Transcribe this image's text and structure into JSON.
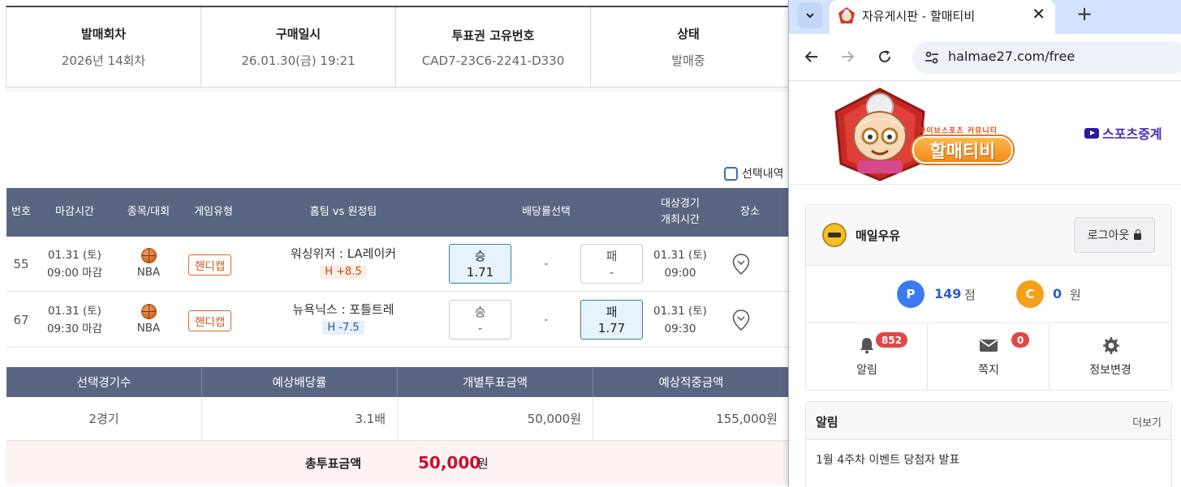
{
  "purchase_info": {
    "round_label": "발매회차",
    "round_value": "2026년 14회차",
    "date_label": "구매일시",
    "date_value": "26.01.30(금) 19:21",
    "id_label": "투표권 고유번호",
    "id_value": "CAD7-23C6-2241-D330",
    "status_label": "상태",
    "status_value": "발매중"
  },
  "selection_toggle_label": "선택내역",
  "game_table": {
    "headers": {
      "num": "번호",
      "deadline": "마감시간",
      "sport": "종목/대회",
      "type": "게임유형",
      "teams": "홈팀 vs 원정팀",
      "odds": "배당률선택",
      "start_line1": "대상경기",
      "start_line2": "개최시간",
      "venue": "장소"
    },
    "rows": [
      {
        "num": "55",
        "deadline_date": "01.31 (토)",
        "deadline_time": "09:00 마감",
        "league": "NBA",
        "game_type": "핸디캡",
        "teams": "워싱위저 : LA레이커",
        "handicap": "H +8.5",
        "win_label": "승",
        "win_odds": "1.71",
        "draw": "-",
        "lose_label": "패",
        "lose_odds": "-",
        "selected": "win",
        "start_date": "01.31 (토)",
        "start_time": "09:00"
      },
      {
        "num": "67",
        "deadline_date": "01.31 (토)",
        "deadline_time": "09:30 마감",
        "league": "NBA",
        "game_type": "핸디캡",
        "teams": "뉴욕닉스 : 포틀트레",
        "handicap": "H -7.5",
        "win_label": "승",
        "win_odds": "-",
        "draw": "-",
        "lose_label": "패",
        "lose_odds": "1.77",
        "selected": "lose",
        "start_date": "01.31 (토)",
        "start_time": "09:30"
      }
    ]
  },
  "summary": {
    "headers": [
      "선택경기수",
      "예상배당률",
      "개별투표금액",
      "예상적중금액"
    ],
    "values": [
      "2경기",
      "3.1배",
      "50,000원",
      "155,000원"
    ],
    "total_label": "총투표금액",
    "total_amount": "50,000",
    "total_unit": "원"
  },
  "browser": {
    "tab_title": "자유게시판 - 할매티비",
    "url": "halmae27.com/free"
  },
  "site": {
    "logo_subtitle": "라이브스포츠 커뮤니티",
    "logo_title": "할매티비",
    "sports_link": "스포츠중계",
    "user": {
      "name": "매일우유",
      "logout_label": "로그아웃",
      "points_badge": "P",
      "points": "149",
      "points_unit": "점",
      "coins_badge": "C",
      "coins": "0",
      "coins_unit": "원",
      "alarm_label": "알림",
      "alarm_count": "852",
      "message_label": "쪽지",
      "message_count": "0",
      "settings_label": "정보변경"
    },
    "notice": {
      "title": "알림",
      "more_label": "더보기",
      "items": [
        "1월 4주차 이벤트 당첨자 발표"
      ]
    }
  },
  "colors": {
    "table_header": "#5a6582",
    "total_red": "#c8102e",
    "selected_odds_bg": "#e6f3fc",
    "points_blue": "#3a7bf0",
    "coins_orange": "#f5a01a",
    "badge_red": "#e04848"
  }
}
